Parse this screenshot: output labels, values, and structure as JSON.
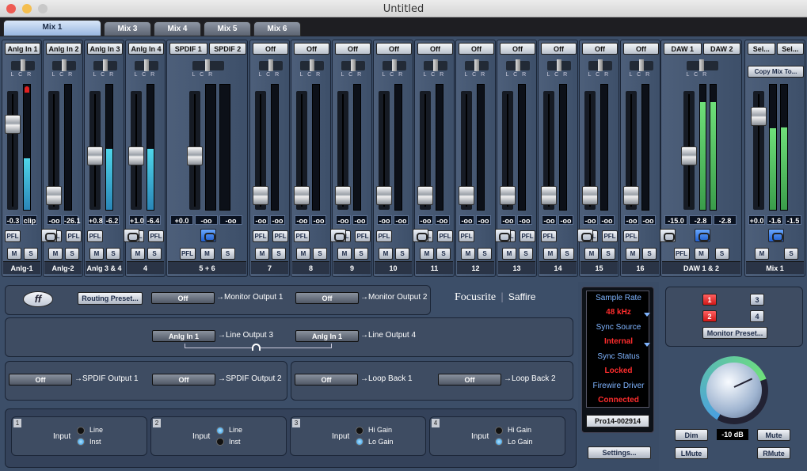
{
  "window": {
    "title": "Untitled"
  },
  "tabs": [
    "Mix 1",
    "Mix 3",
    "Mix 4",
    "Mix 5",
    "Mix 6"
  ],
  "strips": [
    {
      "src": "Anlg In 1",
      "lr": "L   C   R",
      "read1": "-0.3",
      "read2": "clip",
      "name": "Anlg-1"
    },
    {
      "src": "Anlg In 2",
      "lr": "L   C   R",
      "read1": "-oo",
      "read2": "-26.1",
      "name": "Anlg-2"
    },
    {
      "src": "Anlg In 3",
      "lr": "L   C   R",
      "read1": "+0.8",
      "read2": "-6.2",
      "name": "Anlg 3 & 4"
    },
    {
      "src": "Anlg In 4",
      "lr": "L   C   R",
      "read1": "+1.0",
      "read2": "-6.4",
      "name": "4"
    },
    {
      "src": "SPDIF 1",
      "src2": "SPDIF 2",
      "lr": "L   C   R",
      "read1": "+0.0",
      "read2": "-oo",
      "read3": "-oo",
      "name": "5 + 6"
    },
    {
      "src": "Off",
      "lr": "L   C   R",
      "read1": "-oo",
      "read2": "-oo",
      "name": "7"
    },
    {
      "src": "Off",
      "lr": "L   C   R",
      "read1": "-oo",
      "read2": "-oo",
      "name": "8"
    },
    {
      "src": "Off",
      "lr": "L   C   R",
      "read1": "-oo",
      "read2": "-oo",
      "name": "9"
    },
    {
      "src": "Off",
      "lr": "L   C   R",
      "read1": "-oo",
      "read2": "-oo",
      "name": "10"
    },
    {
      "src": "Off",
      "lr": "L   C   R",
      "read1": "-oo",
      "read2": "-oo",
      "name": "11"
    },
    {
      "src": "Off",
      "lr": "L   C   R",
      "read1": "-oo",
      "read2": "-oo",
      "name": "12"
    },
    {
      "src": "Off",
      "lr": "L   C   R",
      "read1": "-oo",
      "read2": "-oo",
      "name": "13"
    },
    {
      "src": "Off",
      "lr": "L   C   R",
      "read1": "-oo",
      "read2": "-oo",
      "name": "14"
    },
    {
      "src": "Off",
      "lr": "L   C   R",
      "read1": "-oo",
      "read2": "-oo",
      "name": "15"
    },
    {
      "src": "Off",
      "lr": "L   C   R",
      "read1": "-oo",
      "read2": "-oo",
      "name": "16"
    },
    {
      "src": "DAW 1",
      "src2": "DAW 2",
      "lr": "L   C   R",
      "read1": "-15.0",
      "read2": "-2.8",
      "read3": "-2.8",
      "name": "DAW 1 & 2"
    },
    {
      "src": "Sel...",
      "src2": "Sel...",
      "copy": "Copy Mix To...",
      "read1": "+0.0",
      "read2": "-1.6",
      "read3": "-1.5",
      "name": "Mix 1"
    }
  ],
  "buttons": {
    "pfl": "PFL",
    "mute": "M",
    "solo": "S"
  },
  "routing": {
    "preset": "Routing Preset...",
    "brand": "Focusrite",
    "product": "Saffire",
    "mon1_src": "Off",
    "mon1": "→Monitor Output 1",
    "mon2_src": "Off",
    "mon2": "→Monitor Output 2",
    "line3_src": "Anlg In 1",
    "line3": "→Line Output 3",
    "line4_src": "Anlg In 1",
    "line4": "→Line Output 4",
    "spdif1_src": "Off",
    "spdif1": "→SPDIF Output 1",
    "spdif2_src": "Off",
    "spdif2": "→SPDIF Output 2",
    "loop1_src": "Off",
    "loop1": "→Loop Back 1",
    "loop2_src": "Off",
    "loop2": "→Loop Back 2"
  },
  "inputs": [
    {
      "num": "1",
      "label": "Input",
      "opt1": "Line",
      "opt2": "Inst"
    },
    {
      "num": "2",
      "label": "Input",
      "opt1": "Line",
      "opt2": "Inst"
    },
    {
      "num": "3",
      "label": "Input",
      "opt1": "Hi Gain",
      "opt2": "Lo Gain"
    },
    {
      "num": "4",
      "label": "Input",
      "opt1": "Hi Gain",
      "opt2": "Lo Gain"
    }
  ],
  "status": {
    "sr_label": "Sample Rate",
    "sr": "48 kHz",
    "sync_label": "Sync Source",
    "sync": "Internal",
    "stat_label": "Sync Status",
    "stat": "Locked",
    "fw_label": "Firewire Driver",
    "fw": "Connected",
    "device": "Pro14-002914",
    "settings": "Settings..."
  },
  "monitor": {
    "a1": "1",
    "a2": "2",
    "a3": "3",
    "a4": "4",
    "preset": "Monitor Preset...",
    "dim": "Dim",
    "level": "-10 dB",
    "mute": "Mute",
    "lmute": "LMute",
    "rmute": "RMute"
  },
  "colors": {
    "accent": "#98b6e0",
    "meter": "#4fd6ea",
    "status_red": "#ff2d2d"
  }
}
